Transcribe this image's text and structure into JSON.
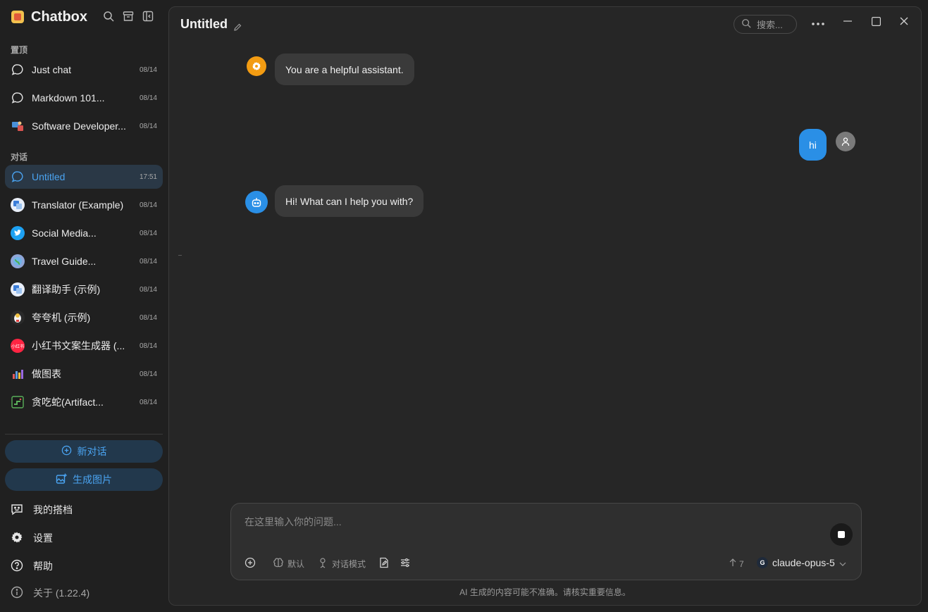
{
  "sidebar": {
    "brand": "Chatbox",
    "pinned_label": "置顶",
    "pinned": [
      {
        "label": "Just chat",
        "date": "08/14"
      },
      {
        "label": "Markdown 101...",
        "date": "08/14"
      },
      {
        "label": "Software Developer...",
        "date": "08/14"
      }
    ],
    "chats_label": "对话",
    "chats": [
      {
        "label": "Untitled",
        "date": "17:51"
      },
      {
        "label": "Translator (Example)",
        "date": "08/14"
      },
      {
        "label": "Social Media...",
        "date": "08/14"
      },
      {
        "label": "Travel Guide...",
        "date": "08/14"
      },
      {
        "label": "翻译助手 (示例)",
        "date": "08/14"
      },
      {
        "label": "夸夸机 (示例)",
        "date": "08/14"
      },
      {
        "label": "小红书文案生成器 (...",
        "date": "08/14"
      },
      {
        "label": "做图表",
        "date": "08/14"
      },
      {
        "label": "贪吃蛇(Artifact...",
        "date": "08/14"
      }
    ],
    "new_chat": "新对话",
    "gen_image": "生成图片",
    "my_copilots": "我的搭档",
    "settings": "设置",
    "help": "帮助",
    "about": "关于 (1.22.4)",
    "xhs_badge": "小红书"
  },
  "header": {
    "title": "Untitled",
    "search_placeholder": "搜索..."
  },
  "messages": {
    "system": "You are a helpful assistant.",
    "user": "hi",
    "assistant": "Hi! What can I help you with?"
  },
  "input": {
    "placeholder": "在这里输入你的问题...",
    "default_label": "默认",
    "chat_mode": "对话模式",
    "token_count": "7",
    "model": "claude-opus-5",
    "model_badge": "G"
  },
  "disclaimer": "AI 生成的内容可能不准确。请核实重要信息。",
  "colors": {
    "accent": "#2a8fe6",
    "active_bg": "#2a3846",
    "system_avatar": "#f39c12"
  }
}
